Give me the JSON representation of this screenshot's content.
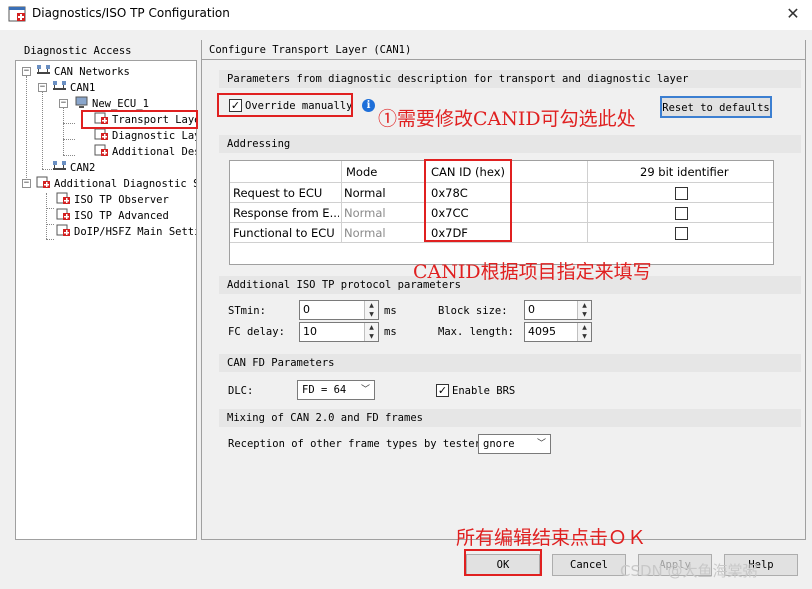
{
  "window": {
    "title": "Diagnostics/ISO TP Configuration",
    "close_glyph": "✕"
  },
  "left": {
    "caption": "Diagnostic Access",
    "tree": [
      {
        "label": "CAN Networks",
        "icon": "network-icon"
      },
      {
        "label": "CAN1",
        "icon": "network-icon"
      },
      {
        "label": "New_ECU_1",
        "icon": "ecu-icon"
      },
      {
        "label": "Transport Layer",
        "icon": "settings-page-icon"
      },
      {
        "label": "Diagnostic Layer",
        "icon": "settings-page-icon"
      },
      {
        "label": "Additional Descriptions",
        "icon": "settings-page-icon"
      },
      {
        "label": "CAN2",
        "icon": "network-icon"
      },
      {
        "label": "Additional Diagnostic Settings",
        "icon": "settings-page-icon"
      },
      {
        "label": "ISO TP Observer",
        "icon": "settings-page-icon"
      },
      {
        "label": "ISO TP Advanced",
        "icon": "settings-page-icon"
      },
      {
        "label": "DoIP/HSFZ Main Settings",
        "icon": "settings-page-icon"
      }
    ]
  },
  "right": {
    "header": "Configure Transport Layer (CAN1)",
    "params_section": "Parameters from diagnostic description for transport and diagnostic layer",
    "override_label": "Override manually",
    "override_checked": true,
    "reset_button": "Reset to defaults",
    "addressing_section": "Addressing",
    "addressing": {
      "columns": [
        "",
        "Mode",
        "CAN ID (hex)",
        "29 bit identifier"
      ],
      "rows": [
        {
          "name": "Request to ECU",
          "mode": "Normal",
          "mode_enabled": true,
          "can_id": "0x78C",
          "ext29": false
        },
        {
          "name": "Response from E...",
          "mode": "Normal",
          "mode_enabled": false,
          "can_id": "0x7CC",
          "ext29": false
        },
        {
          "name": "Functional to ECU",
          "mode": "Normal",
          "mode_enabled": false,
          "can_id": "0x7DF",
          "ext29": false
        }
      ]
    },
    "iso_tp_section": "Additional ISO TP protocol parameters",
    "stmin_label": "STmin:",
    "stmin_value": "0",
    "stmin_unit": "ms",
    "fcdelay_label": "FC delay:",
    "fcdelay_value": "10",
    "fcdelay_unit": "ms",
    "blocksize_label": "Block size:",
    "blocksize_value": "0",
    "maxlen_label": "Max. length:",
    "maxlen_value": "4095",
    "canfd_section": "CAN FD Parameters",
    "dlc_label": "DLC:",
    "dlc_value": "FD = 64",
    "brs_label": "Enable BRS",
    "brs_checked": true,
    "mixing_section": "Mixing of CAN 2.0 and FD frames",
    "reception_label": "Reception of other frame types by tester:",
    "reception_value": "gnore"
  },
  "footer": {
    "ok": "OK",
    "cancel": "Cancel",
    "apply": "Apply",
    "help": "Help"
  },
  "annotations": {
    "note_canid": "①需要修改CANID可勾选此处",
    "note_project": "CANID根据项目指定来填写",
    "note_ok": "所有编辑结束点击ＯＫ",
    "watermark": "CSDN @大鱼海棠粥"
  },
  "colors": {
    "annotation_red": "#e02020",
    "info_blue": "#1e6fd9",
    "reset_focus_blue": "#3c7fd1"
  }
}
